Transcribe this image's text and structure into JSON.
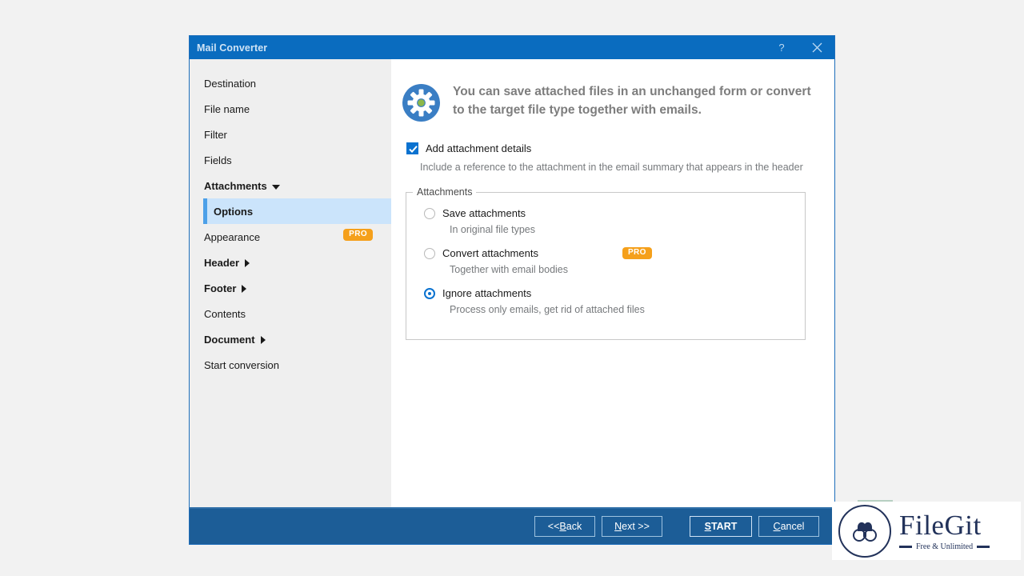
{
  "window": {
    "title": "Mail Converter",
    "help_icon": "question-mark-icon",
    "close_icon": "close-icon"
  },
  "sidebar": {
    "items": [
      {
        "label": "Destination",
        "bold": false,
        "caret": "",
        "badge": "",
        "selected": false
      },
      {
        "label": "File name",
        "bold": false,
        "caret": "",
        "badge": "",
        "selected": false
      },
      {
        "label": "Filter",
        "bold": false,
        "caret": "",
        "badge": "",
        "selected": false
      },
      {
        "label": "Fields",
        "bold": false,
        "caret": "",
        "badge": "",
        "selected": false
      },
      {
        "label": "Attachments",
        "bold": true,
        "caret": "down",
        "badge": "",
        "selected": false
      },
      {
        "label": "Options",
        "bold": true,
        "caret": "",
        "badge": "",
        "selected": true
      },
      {
        "label": "Appearance",
        "bold": false,
        "caret": "",
        "badge": "PRO",
        "selected": false
      },
      {
        "label": "Header",
        "bold": true,
        "caret": "right",
        "badge": "",
        "selected": false
      },
      {
        "label": "Footer",
        "bold": true,
        "caret": "right",
        "badge": "",
        "selected": false
      },
      {
        "label": "Contents",
        "bold": false,
        "caret": "",
        "badge": "",
        "selected": false
      },
      {
        "label": "Document",
        "bold": true,
        "caret": "right",
        "badge": "",
        "selected": false
      },
      {
        "label": "Start conversion",
        "bold": false,
        "caret": "",
        "badge": "",
        "selected": false
      }
    ]
  },
  "content": {
    "intro_icon": "gear-icon",
    "intro_text": "You can save attached files in an unchanged form or convert to the target file type together with emails.",
    "checkbox": {
      "label": "Add attachment details",
      "checked": true,
      "description": "Include a reference to the attachment in the email summary that appears in the header"
    },
    "group": {
      "legend": "Attachments",
      "options": [
        {
          "label": "Save attachments",
          "description": "In original file types",
          "selected": false,
          "badge": ""
        },
        {
          "label": "Convert attachments",
          "description": "Together with email bodies",
          "selected": false,
          "badge": "PRO"
        },
        {
          "label": "Ignore attachments",
          "description": "Process only emails, get rid of attached files",
          "selected": true,
          "badge": ""
        }
      ]
    }
  },
  "footer": {
    "back": "<< Back",
    "back_pre": "<< ",
    "back_key": "B",
    "back_post": "ack",
    "next_key": "N",
    "next_post": "ext >>",
    "start_key": "S",
    "start_post": "TART",
    "cancel_key": "C",
    "cancel_post": "ancel"
  },
  "watermark": {
    "name": "FileGit",
    "tagline": "Free & Unlimited",
    "logo_icon": "binoculars-icon"
  },
  "colors": {
    "titlebar": "#0a6cbf",
    "footer": "#1c5d97",
    "accent": "#0a72d0",
    "selection": "#cbe4fb",
    "pro_badge": "#f5a01b",
    "sidebar_bg": "#efefef"
  }
}
